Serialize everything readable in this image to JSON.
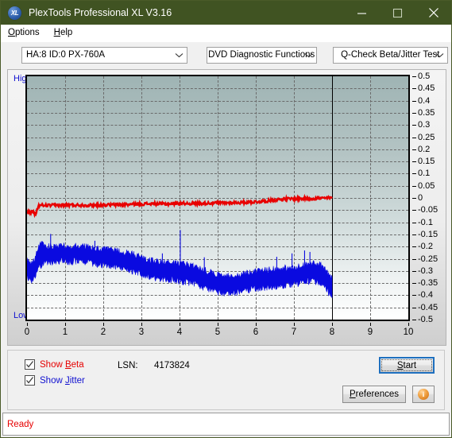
{
  "window": {
    "title": "PlexTools Professional XL V3.16",
    "icon": "xl-app-icon",
    "icon_text": "XL",
    "minimize_label": "Minimize",
    "maximize_label": "Maximize",
    "close_label": "Close",
    "titlebar_color": "#405322"
  },
  "menubar": {
    "items": [
      {
        "label": "Options",
        "accel": "O"
      },
      {
        "label": "Help",
        "accel": "H"
      }
    ]
  },
  "toolbar": {
    "drive_select": {
      "value": "HA:8 ID:0  PX-760A"
    },
    "function_select": {
      "value": "DVD Diagnostic Functions"
    },
    "test_select": {
      "value": "Q-Check Beta/Jitter Test"
    }
  },
  "chart_panel": {
    "axis_high_label": "High",
    "axis_low_label": "Low"
  },
  "controls": {
    "show_beta": {
      "label_prefix": "Show ",
      "accel": "B",
      "label_suffix": "eta",
      "checked": true,
      "color": "#e60000"
    },
    "show_jitter": {
      "label_prefix": "Show ",
      "accel": "J",
      "label_suffix": "itter",
      "checked": true,
      "color": "#1010d0"
    },
    "lsn_label": "LSN:",
    "lsn_value": "4173824",
    "start_button": {
      "prefix": "",
      "accel": "S",
      "suffix": "tart"
    },
    "preferences_button": {
      "prefix": "",
      "accel": "P",
      "suffix": "references"
    },
    "info_button": {
      "glyph": "i",
      "name": "info-icon"
    }
  },
  "statusbar": {
    "text": "Ready",
    "color": "#e60000"
  },
  "chart_data": {
    "type": "line",
    "title": "",
    "xlabel": "",
    "ylabel": "",
    "xlim": [
      0,
      10
    ],
    "ylim": [
      -0.5,
      0.5
    ],
    "grid": true,
    "legend": "none",
    "x_ticks": [
      0,
      1,
      2,
      3,
      4,
      5,
      6,
      7,
      8,
      9,
      10
    ],
    "y_ticks": [
      0.5,
      0.45,
      0.4,
      0.35,
      0.3,
      0.25,
      0.2,
      0.15,
      0.1,
      0.05,
      0,
      -0.05,
      -0.1,
      -0.15,
      -0.2,
      -0.25,
      -0.3,
      -0.35,
      -0.4,
      -0.45,
      -0.5
    ],
    "y_tick_labels": [
      "0.5",
      "0.45",
      "0.4",
      "0.35",
      "0.3",
      "0.25",
      "0.2",
      "0.15",
      "0.1",
      "0.05",
      "0",
      "-0.05",
      "-0.1",
      "-0.15",
      "-0.2",
      "-0.25",
      "-0.3",
      "-0.35",
      "-0.4",
      "-0.45",
      "-0.5"
    ],
    "x_gridlines": [
      1,
      2,
      3,
      4,
      5,
      6,
      7,
      9
    ],
    "y_gridlines": [
      0.45,
      0.4,
      0.35,
      0.3,
      0.25,
      0.2,
      0.15,
      0.1,
      0.05,
      0,
      -0.05,
      -0.1,
      -0.15,
      -0.2,
      -0.25,
      -0.3,
      -0.35,
      -0.4,
      -0.45
    ],
    "data_end_marker_x": 8,
    "series": [
      {
        "name": "Beta",
        "color": "#e80000",
        "x_start": 0,
        "x_end": 8,
        "noise": 0.006,
        "x": [
          0.0,
          0.08,
          0.15,
          0.22,
          0.3,
          0.4,
          0.6,
          0.9,
          1.2,
          1.6,
          2.0,
          2.4,
          2.8,
          3.2,
          3.6,
          4.0,
          4.4,
          4.8,
          5.2,
          5.6,
          6.0,
          6.3,
          6.6,
          6.9,
          7.2,
          7.5,
          7.8,
          8.0
        ],
        "values": [
          -0.055,
          -0.057,
          -0.056,
          -0.07,
          -0.032,
          -0.03,
          -0.031,
          -0.03,
          -0.029,
          -0.03,
          -0.029,
          -0.028,
          -0.026,
          -0.024,
          -0.025,
          -0.022,
          -0.023,
          -0.021,
          -0.02,
          -0.019,
          -0.016,
          -0.012,
          -0.006,
          -0.004,
          -0.003,
          -0.002,
          -0.001,
          0.0
        ]
      },
      {
        "name": "Jitter",
        "color": "#0a0ae0",
        "x_start": 0,
        "x_end": 8,
        "description": "noisy band rendered as filled envelope between upper and lower bounds",
        "x": [
          0.0,
          0.1,
          0.2,
          0.3,
          0.4,
          0.5,
          0.7,
          0.9,
          1.1,
          1.3,
          1.5,
          1.7,
          1.9,
          2.1,
          2.3,
          2.5,
          2.7,
          2.9,
          3.1,
          3.3,
          3.5,
          3.7,
          3.9,
          4.1,
          4.3,
          4.5,
          4.7,
          4.9,
          5.1,
          5.3,
          5.5,
          5.7,
          5.9,
          6.1,
          6.3,
          6.5,
          6.7,
          6.9,
          7.1,
          7.3,
          7.5,
          7.7,
          7.85,
          8.0
        ],
        "upper": [
          -0.255,
          -0.27,
          -0.255,
          -0.195,
          -0.19,
          -0.2,
          -0.198,
          -0.197,
          -0.2,
          -0.196,
          -0.2,
          -0.205,
          -0.21,
          -0.212,
          -0.216,
          -0.22,
          -0.228,
          -0.238,
          -0.25,
          -0.258,
          -0.262,
          -0.266,
          -0.27,
          -0.272,
          -0.278,
          -0.288,
          -0.3,
          -0.312,
          -0.318,
          -0.322,
          -0.32,
          -0.312,
          -0.306,
          -0.3,
          -0.296,
          -0.292,
          -0.29,
          -0.286,
          -0.282,
          -0.276,
          -0.268,
          -0.276,
          -0.3,
          -0.335
        ],
        "lower": [
          -0.32,
          -0.34,
          -0.33,
          -0.288,
          -0.272,
          -0.268,
          -0.262,
          -0.258,
          -0.262,
          -0.258,
          -0.262,
          -0.268,
          -0.272,
          -0.276,
          -0.282,
          -0.288,
          -0.296,
          -0.306,
          -0.318,
          -0.326,
          -0.33,
          -0.334,
          -0.34,
          -0.344,
          -0.35,
          -0.36,
          -0.372,
          -0.382,
          -0.388,
          -0.392,
          -0.39,
          -0.382,
          -0.376,
          -0.37,
          -0.366,
          -0.362,
          -0.36,
          -0.356,
          -0.352,
          -0.346,
          -0.338,
          -0.348,
          -0.376,
          -0.408
        ],
        "spikes": [
          {
            "x": 0.62,
            "y": -0.148
          },
          {
            "x": 1.78,
            "y": -0.176
          },
          {
            "x": 3.55,
            "y": -0.228
          },
          {
            "x": 4.02,
            "y": -0.132
          },
          {
            "x": 4.65,
            "y": -0.244
          },
          {
            "x": 6.55,
            "y": -0.242
          },
          {
            "x": 6.95,
            "y": -0.228
          },
          {
            "x": 7.28,
            "y": -0.216
          },
          {
            "x": 7.42,
            "y": -0.222
          }
        ]
      }
    ]
  }
}
